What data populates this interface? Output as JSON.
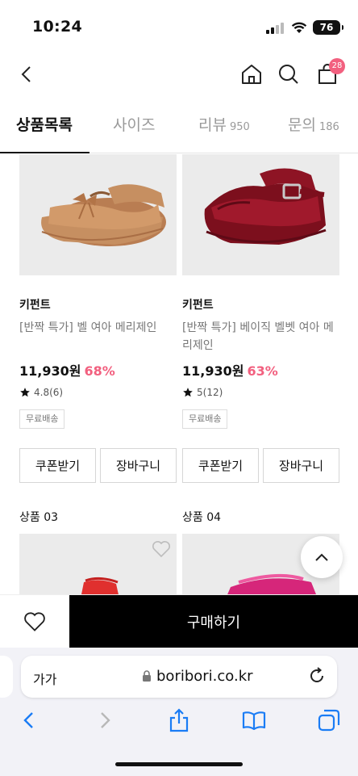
{
  "status": {
    "time": "10:24",
    "battery": "76"
  },
  "header": {
    "cart_count": "28"
  },
  "tabs": [
    {
      "label": "상품목록",
      "count": ""
    },
    {
      "label": "사이즈",
      "count": ""
    },
    {
      "label": "리뷰",
      "count": "950"
    },
    {
      "label": "문의",
      "count": "186"
    }
  ],
  "products": [
    {
      "brand": "키펀트",
      "name": "[반짝 특가] 벨 여아 메리제인",
      "price": "11,930원",
      "discount": "68%",
      "rating": "4.8(6)",
      "tag": "무료배송",
      "coupon_label": "쿠폰받기",
      "cart_label": "장바구니",
      "shoe_color": "#c68f61"
    },
    {
      "brand": "키펀트",
      "name": "[반짝 특가] 베이직 벨벳 여아 메리제인",
      "price": "11,930원",
      "discount": "63%",
      "rating": "5(12)",
      "tag": "무료배송",
      "coupon_label": "쿠폰받기",
      "cart_label": "장바구니",
      "shoe_color": "#8e1424"
    }
  ],
  "next_products": [
    {
      "label": "상품 03"
    },
    {
      "label": "상품 04"
    }
  ],
  "action_bar": {
    "buy_label": "구매하기"
  },
  "browser": {
    "text_size": "가가",
    "url": "boribori.co.kr"
  },
  "colors": {
    "accent": "#f2607f",
    "buy_bg": "#000000"
  }
}
